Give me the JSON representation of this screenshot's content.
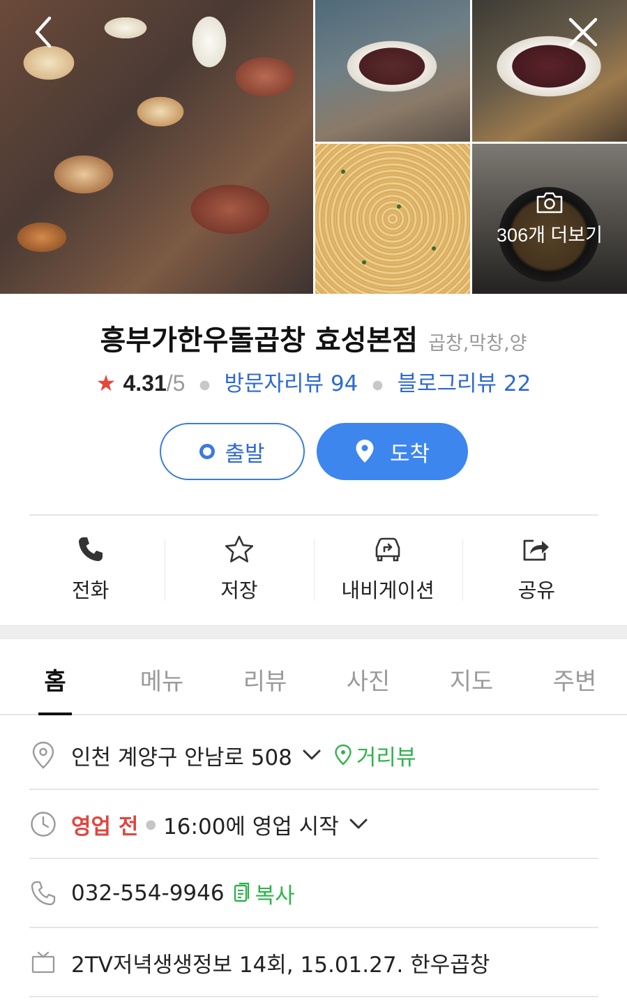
{
  "photos": {
    "more_label": "306개 더보기"
  },
  "place": {
    "name": "흥부가한우돌곱창 효성본점",
    "category": "곱창,막창,양",
    "rating": "4.31",
    "rating_max": "/5",
    "visitor_reviews": "방문자리뷰 94",
    "blog_reviews": "블로그리뷰 22"
  },
  "route": {
    "start_label": "출발",
    "arrive_label": "도착"
  },
  "actions": [
    {
      "label": "전화",
      "icon": "phone-icon"
    },
    {
      "label": "저장",
      "icon": "star-icon"
    },
    {
      "label": "내비게이션",
      "icon": "car-navigation-icon"
    },
    {
      "label": "공유",
      "icon": "share-icon"
    }
  ],
  "tabs": [
    "홈",
    "메뉴",
    "리뷰",
    "사진",
    "지도",
    "주변"
  ],
  "info": {
    "address": "인천 계양구 안남로 508",
    "streetview": "거리뷰",
    "status": "영업 전",
    "hours": "16:00에 영업 시작",
    "phone": "032-554-9946",
    "copy": "복사",
    "tv": "2TV저녁생생정보 14회, 15.01.27. 한우곱창"
  },
  "colors": {
    "accent_blue": "#3d86ee",
    "link_blue": "#2e6ad0",
    "green": "#2fb24c",
    "red": "#e0463f",
    "star_red": "#e8453c"
  }
}
